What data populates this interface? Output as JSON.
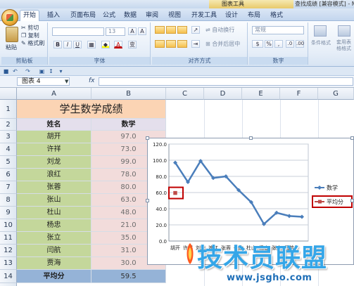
{
  "title_bar": {
    "context_tab_group": "图表工具",
    "window_title": "查找成绩 [兼容模式] - M"
  },
  "ribbon_tabs": [
    {
      "label": "开始",
      "active": true
    },
    {
      "label": "插入",
      "active": false
    },
    {
      "label": "页面布局",
      "active": false
    },
    {
      "label": "公式",
      "active": false
    },
    {
      "label": "数据",
      "active": false
    },
    {
      "label": "审阅",
      "active": false
    },
    {
      "label": "视图",
      "active": false
    },
    {
      "label": "开发工具",
      "active": false
    },
    {
      "label": "设计",
      "active": false
    },
    {
      "label": "布局",
      "active": false
    },
    {
      "label": "格式",
      "active": false
    }
  ],
  "ribbon": {
    "clipboard": {
      "cut": "剪切",
      "copy": "复制",
      "format_painter": "格式刷",
      "paste": "粘贴",
      "label": "剪贴板"
    },
    "font": {
      "size": "13",
      "grow": "A",
      "shrink": "A",
      "bold": "B",
      "italic": "I",
      "underline": "U",
      "font_color": "A",
      "phonetic": "变",
      "label": "字体"
    },
    "alignment": {
      "wrap_text": "自动换行",
      "merge_center": "合并后居中",
      "label": "对齐方式"
    },
    "number": {
      "format": "常规",
      "percent": "%",
      "comma": ",",
      "label": "数字"
    },
    "styles": {
      "conditional": "条件格式",
      "table_format": "套用表格格式"
    }
  },
  "name_box": "图表 4",
  "formula_bar": {
    "fx": "fx",
    "value": ""
  },
  "columns": [
    "A",
    "B",
    "C",
    "D",
    "E",
    "F",
    "G"
  ],
  "rows": [
    "1",
    "2",
    "3",
    "4",
    "5",
    "6",
    "7",
    "8",
    "9",
    "10",
    "11",
    "12",
    "13",
    "14",
    "15"
  ],
  "sheet": {
    "title": "学生数学成绩",
    "header": [
      "姓名",
      "数学"
    ],
    "records": [
      {
        "name": "胡开",
        "score": "97.0"
      },
      {
        "name": "许祥",
        "score": "73.0"
      },
      {
        "name": "刘龙",
        "score": "99.0"
      },
      {
        "name": "浪红",
        "score": "78.0"
      },
      {
        "name": "张蓉",
        "score": "80.0"
      },
      {
        "name": "张山",
        "score": "63.0"
      },
      {
        "name": "杜山",
        "score": "48.0"
      },
      {
        "name": "杨忠",
        "score": "21.0"
      },
      {
        "name": "张立",
        "score": "35.0"
      },
      {
        "name": "闫航",
        "score": "31.0"
      },
      {
        "name": "贾海",
        "score": "30.0"
      }
    ],
    "avg_label": "平均分",
    "avg_value": "59.5"
  },
  "chart_data": {
    "type": "line",
    "categories": [
      "胡开",
      "许祥",
      "刘龙",
      "浪红",
      "张蓉",
      "张山",
      "杜山",
      "杨忠",
      "张立",
      "闫航",
      "贾海"
    ],
    "visible_category_labels": [
      "胡开",
      "许祥",
      "刘龙",
      "浪红",
      "张蓉",
      "张山",
      "杜山",
      "杨忠",
      "张立",
      "闫航"
    ],
    "series": [
      {
        "name": "数学",
        "values": [
          97,
          73,
          99,
          78,
          80,
          63,
          48,
          21,
          35,
          31,
          30
        ],
        "color": "#4a7ebb",
        "marker": "diamond"
      },
      {
        "name": "平均分",
        "values": [
          59.5
        ],
        "color": "#be4b48",
        "marker": "square"
      }
    ],
    "y_ticks": [
      "0.0",
      "20.0",
      "40.0",
      "60.0",
      "80.0",
      "100.0",
      "120.0"
    ],
    "ylim": [
      0,
      120
    ],
    "grid": "horizontal",
    "legend": "right",
    "highlight_color": "#c00000"
  },
  "watermark": {
    "text": "技术员联盟",
    "url": "www.jsgho.com"
  }
}
